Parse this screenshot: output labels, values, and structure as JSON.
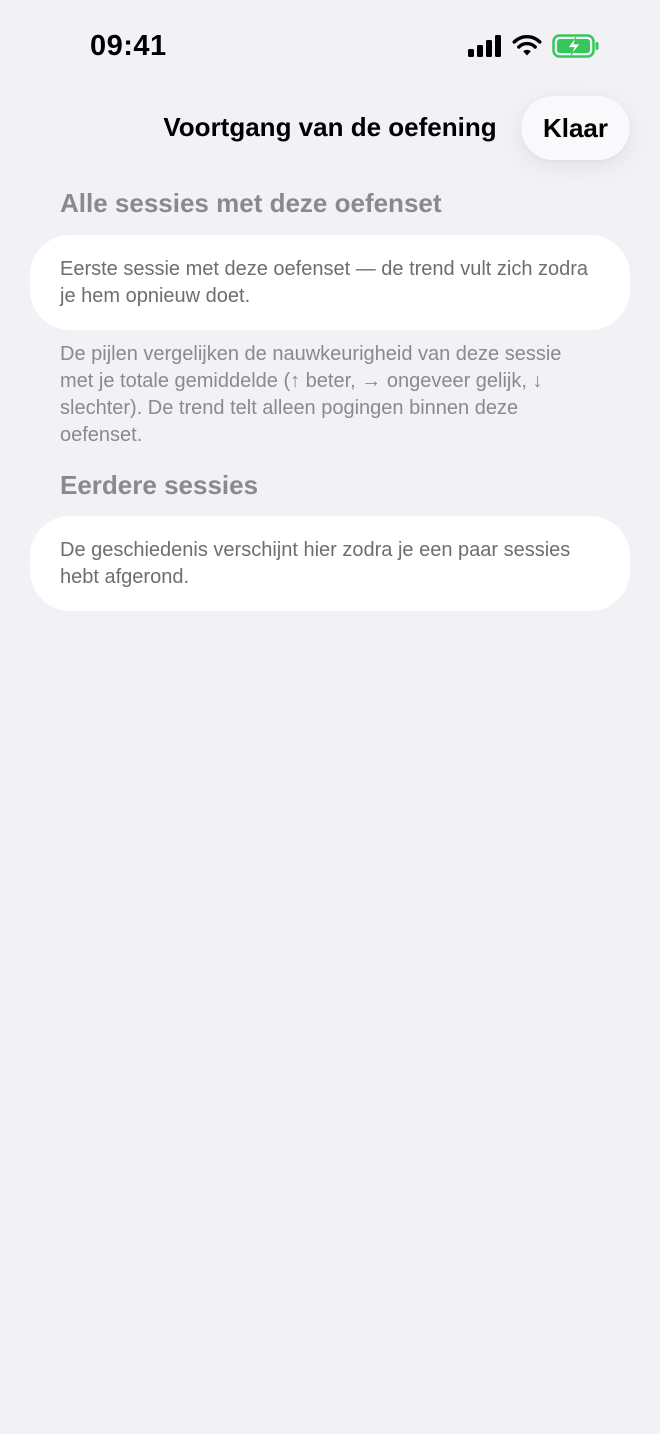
{
  "status_bar": {
    "time": "09:41",
    "icons": [
      "signal-bars-icon",
      "wifi-icon",
      "battery-charging-icon"
    ],
    "battery_color": "#34c759"
  },
  "nav": {
    "title": "Voortgang van de oefening",
    "done_label": "Klaar"
  },
  "sections": {
    "all_sessions": {
      "header": "Alle sessies met deze oefenset",
      "card_text": "Eerste sessie met deze oefenset — de trend vult zich zodra je hem opnieuw doet.",
      "footnote": "De pijlen vergelijken de nauwkeurigheid van deze sessie met je totale gemiddelde (↑ beter, → ongeveer gelijk, ↓ slechter). De trend telt alleen pogingen binnen deze oefenset."
    },
    "previous_sessions": {
      "header": "Eerdere sessies",
      "card_text": "De geschiedenis verschijnt hier zodra je een paar sessies hebt afgerond."
    }
  },
  "colors": {
    "background": "#f2f1f6",
    "card": "#ffffff",
    "secondary_text": "#8a8a8e"
  }
}
